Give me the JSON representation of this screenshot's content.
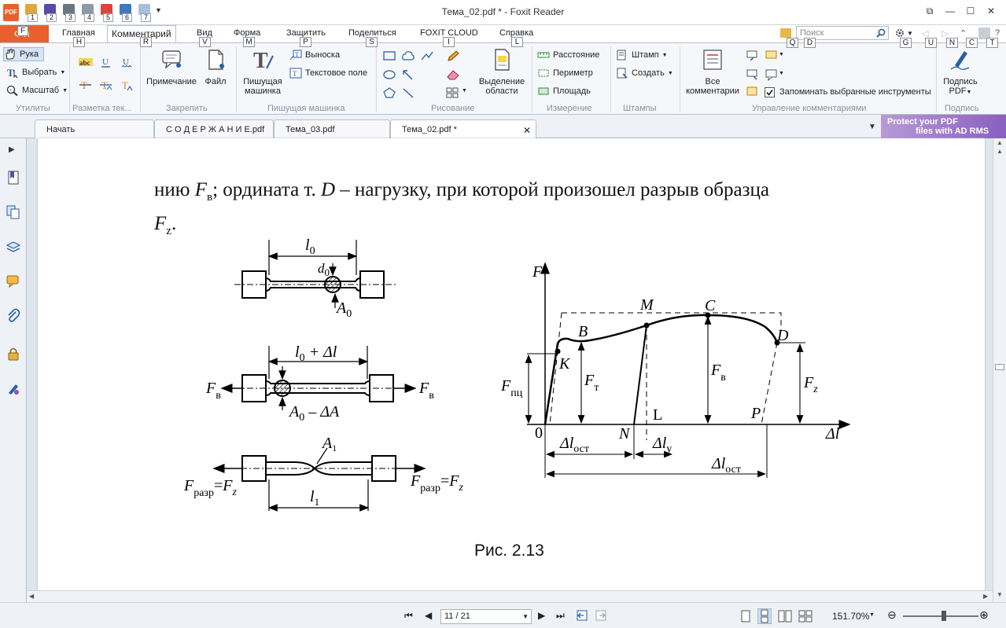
{
  "app": {
    "window_title": "Тема_02.pdf * - Foxit Reader",
    "logo_text": "PDF",
    "qat_keys": [
      "1",
      "2",
      "3",
      "4",
      "5",
      "6",
      "7"
    ]
  },
  "ribbon_tabs": {
    "file": {
      "label": "Ф л",
      "key": "F"
    },
    "items": [
      {
        "label": "Главная",
        "key": "H"
      },
      {
        "label": "Комментарий",
        "key": "R"
      },
      {
        "label": "Вид",
        "key": "V"
      },
      {
        "label": "Форма",
        "key": "M"
      },
      {
        "label": "Защитить",
        "key": "P"
      },
      {
        "label": "Поделиться",
        "key": "S"
      },
      {
        "label": "FOXIT CLOUD",
        "key": "I"
      },
      {
        "label": "Справка",
        "key": "L"
      }
    ],
    "search_placeholder": "Поиск",
    "right_keys": [
      "Q",
      "D",
      "G",
      "U",
      "N",
      "C",
      "T"
    ]
  },
  "ribbon": {
    "utilities": {
      "label": "Утилиты",
      "hand": "Рука",
      "select": "Выбрать",
      "zoom": "Масштаб"
    },
    "markup": {
      "label": "Разметка тек..."
    },
    "pin": {
      "label": "Закрепить",
      "note": "Примечание",
      "file": "Файл"
    },
    "typewriter": {
      "label": "Пишущая машинка",
      "tool_line1": "Пишущая",
      "tool_line2": "машинка",
      "callout": "Выноска",
      "textbox": "Текстовое поле"
    },
    "drawing": {
      "label": "Рисование"
    },
    "area": {
      "line1": "Выделение",
      "line2": "области"
    },
    "measure": {
      "label": "Измерение",
      "distance": "Расстояние",
      "perimeter": "Периметр",
      "area": "Площадь"
    },
    "stamps": {
      "label": "Штампы",
      "stamp": "Штамп",
      "create": "Создать"
    },
    "manage": {
      "label": "Управление комментариями",
      "all_line1": "Все",
      "all_line2": "комментарии",
      "remember": "Запоминать выбранные инструменты"
    },
    "sign": {
      "label": "Подпись",
      "line1": "Подпись",
      "line2": "PDF"
    }
  },
  "doc_tabs": [
    {
      "label": "Начать"
    },
    {
      "label": "С О Д Е Р Ж А Н И Е.pdf"
    },
    {
      "label": "Тема_03.pdf"
    },
    {
      "label": "Тема_02.pdf *"
    }
  ],
  "ad": {
    "line1": "Protect your PDF",
    "line2": "files with AD RMS"
  },
  "document": {
    "text_part1": "нию ",
    "F": "F",
    "sub_v": "в",
    "text_part2": "; ордината т. ",
    "D": "D",
    "text_part3": " – нагрузку, при которой произошел разрыв образца",
    "sub_z": "z",
    "text_part4": ".",
    "caption": "Рис. 2.13"
  },
  "figure": {
    "left": {
      "l0": "l",
      "l0_sub": "0",
      "d0": "d",
      "d0_sub": "0",
      "A0": "A",
      "A0_sub": "0",
      "l0dl": "l",
      "l0dl_sub": "0",
      "l0dl_rest": " + Δl",
      "Fv": "F",
      "Fv_sub": "в",
      "A0dA": "A",
      "A0dA_sub": "0",
      "A0dA_rest": " – ΔA",
      "A1": "A",
      "A1_sub": "1",
      "Fraz": "F",
      "Fraz_sub": "разр",
      "eq": "=",
      "Fz": "F",
      "Fz_sub": "z",
      "l1": "l",
      "l1_sub": "1"
    },
    "right": {
      "F": "F",
      "dl": "Δl",
      "M": "M",
      "C": "C",
      "B": "B",
      "D": "D",
      "K": "K",
      "Fpc": "F",
      "Fpc_sub": "пц",
      "Ft": "F",
      "Ft_sub": "т",
      "Fv": "F",
      "Fv_sub": "в",
      "Fz": "F",
      "Fz_sub": "z",
      "zero": "0",
      "N": "N",
      "L": "L",
      "P": "P",
      "dl_ost": "Δl",
      "dl_ost_sub": "ост",
      "dl_y": "Δl",
      "dl_y_sub": "у"
    }
  },
  "status": {
    "page": "11 / 21",
    "zoom": "151.70%"
  }
}
